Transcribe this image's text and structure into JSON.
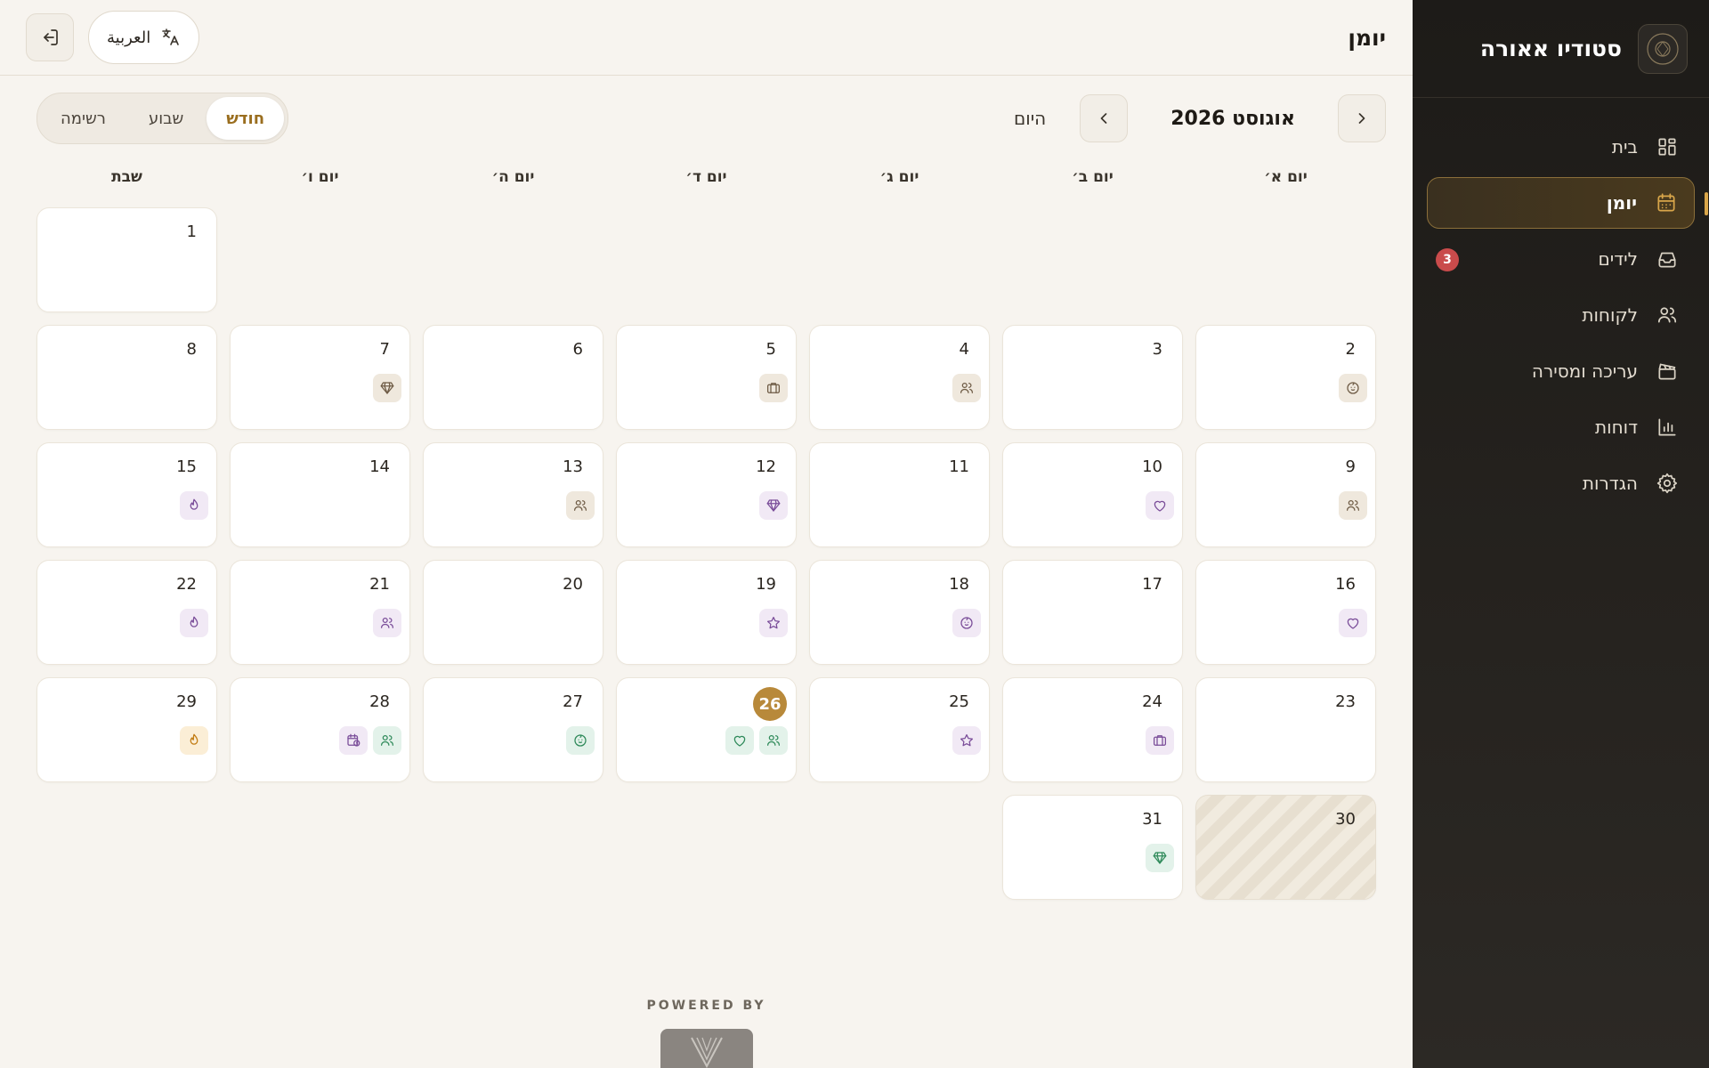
{
  "sidebar": {
    "brand_name": "סטודיו אאורה",
    "items": [
      {
        "key": "home",
        "label": "בית",
        "icon": "grid-icon",
        "active": false
      },
      {
        "key": "calendar",
        "label": "יומן",
        "icon": "calendar-icon",
        "active": true
      },
      {
        "key": "leads",
        "label": "לידים",
        "icon": "inbox-icon",
        "active": false,
        "badge": "3"
      },
      {
        "key": "clients",
        "label": "לקוחות",
        "icon": "users-icon",
        "active": false
      },
      {
        "key": "editing",
        "label": "עריכה ומסירה",
        "icon": "clapperboard-icon",
        "active": false
      },
      {
        "key": "reports",
        "label": "דוחות",
        "icon": "bar-chart-icon",
        "active": false
      },
      {
        "key": "settings",
        "label": "הגדרות",
        "icon": "gear-icon",
        "active": false
      }
    ]
  },
  "header": {
    "title": "יומן",
    "language_label": "العربية"
  },
  "toolbar": {
    "month_label": "אוגוסט 2026",
    "today_label": "היום",
    "views": [
      {
        "key": "month",
        "label": "חודש",
        "active": true
      },
      {
        "key": "week",
        "label": "שבוע",
        "active": false
      },
      {
        "key": "list",
        "label": "רשימה",
        "active": false
      }
    ]
  },
  "weekdays": [
    "יום א׳",
    "יום ב׳",
    "יום ג׳",
    "יום ד׳",
    "יום ה׳",
    "יום ו׳",
    "שבת"
  ],
  "calendar": {
    "today": 26,
    "leading_blanks": 6,
    "days": [
      {
        "d": "1",
        "ev": []
      },
      {
        "d": "2",
        "ev": [
          [
            "baby",
            "brown"
          ]
        ]
      },
      {
        "d": "3",
        "ev": []
      },
      {
        "d": "4",
        "ev": [
          [
            "users",
            "brown"
          ]
        ]
      },
      {
        "d": "5",
        "ev": [
          [
            "briefcase",
            "brown"
          ]
        ]
      },
      {
        "d": "6",
        "ev": []
      },
      {
        "d": "7",
        "ev": [
          [
            "gem",
            "brown"
          ]
        ]
      },
      {
        "d": "8",
        "ev": []
      },
      {
        "d": "9",
        "ev": [
          [
            "users",
            "brown"
          ]
        ]
      },
      {
        "d": "10",
        "ev": [
          [
            "heart",
            "purple"
          ]
        ]
      },
      {
        "d": "11",
        "ev": []
      },
      {
        "d": "12",
        "ev": [
          [
            "gem",
            "purple"
          ]
        ]
      },
      {
        "d": "13",
        "ev": [
          [
            "users",
            "brown"
          ]
        ]
      },
      {
        "d": "14",
        "ev": []
      },
      {
        "d": "15",
        "ev": [
          [
            "flame",
            "purple"
          ]
        ]
      },
      {
        "d": "16",
        "ev": [
          [
            "heart",
            "purple"
          ]
        ]
      },
      {
        "d": "17",
        "ev": []
      },
      {
        "d": "18",
        "ev": [
          [
            "baby",
            "purple"
          ]
        ]
      },
      {
        "d": "19",
        "ev": [
          [
            "star",
            "purple"
          ]
        ]
      },
      {
        "d": "20",
        "ev": []
      },
      {
        "d": "21",
        "ev": [
          [
            "users",
            "purple"
          ]
        ]
      },
      {
        "d": "22",
        "ev": [
          [
            "flame",
            "purple"
          ]
        ]
      },
      {
        "d": "23",
        "ev": []
      },
      {
        "d": "24",
        "ev": [
          [
            "briefcase",
            "purple"
          ]
        ]
      },
      {
        "d": "25",
        "ev": [
          [
            "star",
            "purple"
          ]
        ]
      },
      {
        "d": "26",
        "ev": [
          [
            "users",
            "green"
          ],
          [
            "heart",
            "green"
          ]
        ]
      },
      {
        "d": "27",
        "ev": [
          [
            "baby",
            "green"
          ]
        ]
      },
      {
        "d": "28",
        "ev": [
          [
            "users",
            "green"
          ],
          [
            "calendar-clock",
            "purple"
          ]
        ]
      },
      {
        "d": "29",
        "ev": [
          [
            "flame",
            "gold"
          ]
        ]
      },
      {
        "d": "30",
        "ev": [],
        "hatched": true
      },
      {
        "d": "31",
        "ev": [
          [
            "gem",
            "green"
          ]
        ]
      }
    ]
  },
  "footer": {
    "powered_by": "POWERED BY"
  }
}
